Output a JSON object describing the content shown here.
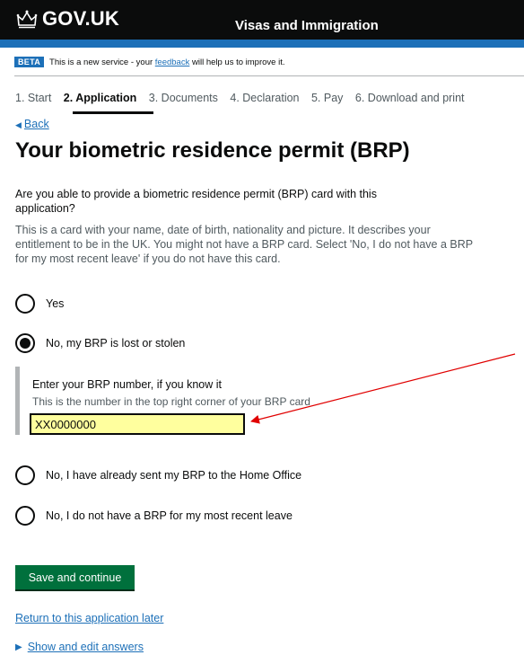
{
  "header": {
    "logo_text": "GOV.UK",
    "logo_icon": "crown-icon",
    "service_name": "Visas and Immigration",
    "accent_color": "#1d70b8"
  },
  "phase_banner": {
    "tag": "BETA",
    "text_before": "This is a new service - your ",
    "link": "feedback",
    "text_after": " will help us to improve it."
  },
  "steps": [
    {
      "label": "1. Start",
      "active": false
    },
    {
      "label": "2. Application",
      "active": true
    },
    {
      "label": "3. Documents",
      "active": false
    },
    {
      "label": "4. Declaration",
      "active": false
    },
    {
      "label": "5. Pay",
      "active": false
    },
    {
      "label": "6. Download and print",
      "active": false
    }
  ],
  "back_link": "Back",
  "page_title": "Your biometric residence permit (BRP)",
  "question": "Are you able to provide a biometric residence permit (BRP) card with this application?",
  "hint": "This is a card with your name, date of birth, nationality and picture. It describes your entitlement to be in the UK. You might not have a BRP card. Select 'No, I do not have a BRP for my most recent leave' if you do not have this card.",
  "options": [
    {
      "label": "Yes",
      "selected": false
    },
    {
      "label": "No, my BRP is lost or stolen",
      "selected": true
    },
    {
      "label": "No, I have already sent my BRP to the Home Office",
      "selected": false
    },
    {
      "label": "No, I do not have a BRP for my most recent leave",
      "selected": false
    }
  ],
  "conditional": {
    "label": "Enter your BRP number, if you know it",
    "hint": "This is the number in the top right corner of your BRP card",
    "value": "XX0000000"
  },
  "annotation_arrow_color": "#e00000",
  "save_button": "Save and continue",
  "return_link": "Return to this application later",
  "details_summary": "Show and edit answers"
}
